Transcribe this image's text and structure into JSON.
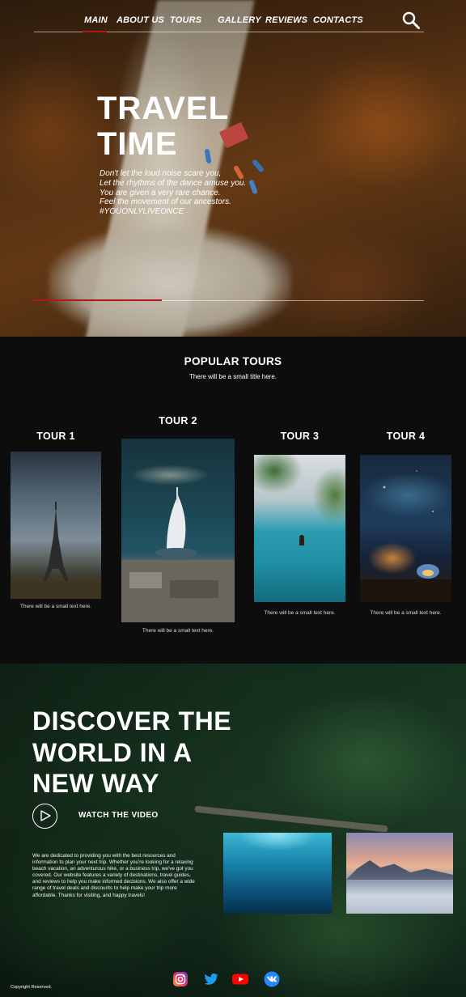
{
  "nav": {
    "items": [
      {
        "label": "MAIN",
        "active": true
      },
      {
        "label": "ABOUT US"
      },
      {
        "label": "TOURS"
      },
      {
        "label": "GALLERY"
      },
      {
        "label": "REVIEWS"
      },
      {
        "label": "CONTACTS"
      }
    ],
    "search_icon": "search-icon"
  },
  "hero": {
    "title_line1": "TRAVEL",
    "title_line2": "TIME",
    "lines": [
      "Don't let the loud noise scare you,",
      "Let the rhythms of the dance amuse you.",
      "You are given a very rare chance.",
      "Feel the movement of our ancestors.",
      "#YOUONLYLIVEONCE"
    ],
    "slider_progress_fraction": 0.33
  },
  "popular": {
    "title": "POPULAR TOURS",
    "subtitle": "There will be a small title here.",
    "tours": [
      {
        "name": "TOUR 1",
        "text": "There will be a small text here."
      },
      {
        "name": "TOUR 2",
        "text": "There will be a small text here."
      },
      {
        "name": "TOUR 3",
        "text": "There will be a small text here."
      },
      {
        "name": "TOUR 4",
        "text": "There will be a small text here."
      }
    ]
  },
  "discover": {
    "title": "DISCOVER THE WORLD IN A NEW WAY",
    "watch_label": "WATCH THE VIDEO",
    "text": "We are dedicated to providing you with the best resources and information to plan your next trip. Whether you're looking for a relaxing beach vacation, an adventurous hike, or a business trip, we've got you covered. Our website features a variety of destinations, travel guides, and reviews to help you make informed decisions. We also offer a wide range of travel deals and discounts to help make your trip more affordable. Thanks for visiting, and happy travels!"
  },
  "footer": {
    "copyright": "Copyright Reserved.",
    "social_icons": [
      "instagram-icon",
      "twitter-icon",
      "youtube-icon",
      "vk-icon"
    ]
  },
  "colors": {
    "accent": "#b01818",
    "background": "#0d0d0d"
  }
}
